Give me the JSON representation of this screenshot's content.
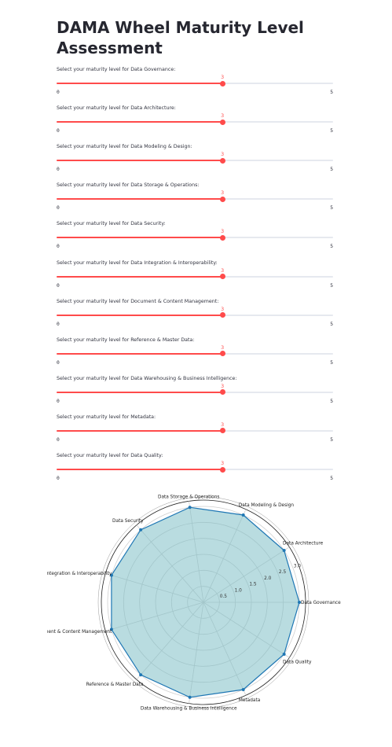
{
  "page": {
    "title": "DAMA Wheel Maturity Level Assessment"
  },
  "sliders": [
    {
      "label": "Select your maturity level for Data Governance:",
      "value": 3,
      "min": 0,
      "max": 5
    },
    {
      "label": "Select your maturity level for Data Architecture:",
      "value": 3,
      "min": 0,
      "max": 5
    },
    {
      "label": "Select your maturity level for Data Modeling & Design:",
      "value": 3,
      "min": 0,
      "max": 5
    },
    {
      "label": "Select your maturity level for Data Storage & Operations:",
      "value": 3,
      "min": 0,
      "max": 5
    },
    {
      "label": "Select your maturity level for Data Security:",
      "value": 3,
      "min": 0,
      "max": 5
    },
    {
      "label": "Select your maturity level for Data Integration & Interoperability:",
      "value": 3,
      "min": 0,
      "max": 5
    },
    {
      "label": "Select your maturity level for Document & Content Management:",
      "value": 3,
      "min": 0,
      "max": 5
    },
    {
      "label": "Select your maturity level for Reference & Master Data:",
      "value": 3,
      "min": 0,
      "max": 5
    },
    {
      "label": "Select your maturity level for Data Warehousing & Business Intelligence:",
      "value": 3,
      "min": 0,
      "max": 5
    },
    {
      "label": "Select your maturity level for Metadata:",
      "value": 3,
      "min": 0,
      "max": 5
    },
    {
      "label": "Select your maturity level for Data Quality:",
      "value": 3,
      "min": 0,
      "max": 5
    }
  ],
  "colors": {
    "accent": "#ff4b4b",
    "track": "#e6e9ef",
    "radar_line": "#1f77b4",
    "radar_fill": "#7fbfc7"
  },
  "chart_data": {
    "type": "radar",
    "categories": [
      "Data Governance",
      "Data Architecture",
      "Data Modeling & Design",
      "Data Storage & Operations",
      "Data Security",
      "Data Integration & Interoperability",
      "Document & Content Management",
      "Reference & Master Data",
      "Data Warehousing & Business Intelligence",
      "Metadata",
      "Data Quality"
    ],
    "values": [
      3,
      3,
      3,
      3,
      3,
      3,
      3,
      3,
      3,
      3,
      3
    ],
    "rlim": [
      0,
      3
    ],
    "rticks": [
      "0.5",
      "1.0",
      "1.5",
      "2.0",
      "2.5",
      "3.0"
    ],
    "rtick_values": [
      0.5,
      1.0,
      1.5,
      2.0,
      2.5,
      3.0
    ],
    "grid": true
  }
}
